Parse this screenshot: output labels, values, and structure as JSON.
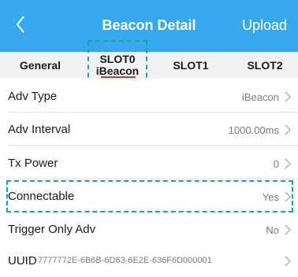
{
  "header": {
    "title": "Beacon Detail",
    "upload_label": "Upload",
    "bg_color": "#36a8ee"
  },
  "tabs": [
    {
      "label": "General"
    },
    {
      "line1": "SLOT0",
      "line2": "iBeacon",
      "active": true
    },
    {
      "label": "SLOT1"
    },
    {
      "label": "SLOT2"
    }
  ],
  "rows": [
    {
      "label": "Adv Type",
      "value": "iBeacon"
    },
    {
      "label": "Adv Interval",
      "value": "1000.00ms"
    },
    {
      "label": "Tx Power",
      "value": "0"
    },
    {
      "label": "Connectable",
      "value": "Yes"
    },
    {
      "label": "Trigger Only Adv",
      "value": "No"
    },
    {
      "label": "UUID",
      "value": "7777772E-6B6B-6D63-6E2E-636F6D000001"
    }
  ],
  "colors": {
    "highlight_dash": "#1aa39a",
    "active_underline": "#e32b2b"
  },
  "icons": {
    "back": "chevron-left-icon",
    "row": "chevron-right-icon"
  }
}
